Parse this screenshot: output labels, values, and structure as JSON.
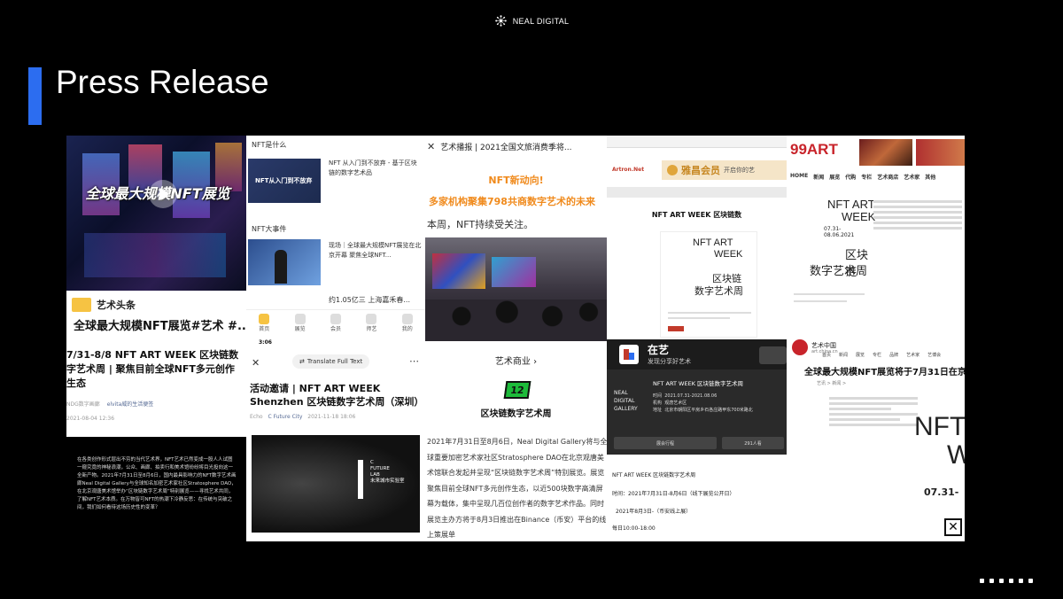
{
  "brand": {
    "name": "NEAL DIGITAL"
  },
  "slide": {
    "title": "Press Release"
  },
  "colors": {
    "accent": "#2c6df0",
    "orange": "#f08a1c",
    "green": "#1dbb3a"
  },
  "p1": {
    "banner": "全球最大规模NFT展览",
    "source": "艺术头条",
    "headline": "全球最大规模NFT展览#艺术 #..."
  },
  "p2": {
    "section1": "NFT是什么",
    "item1_title": "NFT 从入门到不放弃 - 基于区块链的数字艺术品",
    "item1_thumb": "NFT从入门到不放弃",
    "section2": "NFT大事件",
    "item2_title": "现场｜全球最大规模NFT展览在北京开幕 聚焦全球NFT...",
    "item3_title": "约1.05亿三 上海嘉禾春...",
    "tabs": [
      "首页",
      "展览",
      "会员",
      "师艺",
      "我的"
    ]
  },
  "p3": {
    "header": "艺术播报 | 2021全国文旅消费季将...",
    "tag": "NFT新动向!",
    "subtitle": "多家机构聚集798共商数字艺术的未来",
    "body": "本周，NFT持续受关注。"
  },
  "p4": {
    "member": "雅昌会员",
    "member_sub": "开启你的艺",
    "site": "Artron.Net",
    "headline": "NFT ART WEEK 区块链数",
    "poster_l1": "NFT ART",
    "poster_l2": "WEEK",
    "poster_l3": "区块链",
    "poster_l4": "数字艺术周"
  },
  "p5": {
    "logo": "99ART",
    "nav": [
      "HOME",
      "新闻",
      "展览",
      "代购",
      "专栏",
      "艺术商店",
      "艺术家",
      "其他"
    ],
    "poster_l1": "NFT ART",
    "poster_l2": "WEEK",
    "poster_dates": "07.31-08.06.2021",
    "poster_l3": "区块链",
    "poster_l4": "数字艺术周"
  },
  "p6": {
    "headline": "7/31-8/8 NFT ART WEEK 区块链数字艺术周 | 聚焦目前全球NFT多元创作生态",
    "author": "NDG数字画廊",
    "channel": "elvita威的生活便签",
    "date": "2021-08-04 12:36",
    "body": "在各类创作形式层出不穷的当代艺术界，NFT艺术已然变成一股人人试图一窥究竟的神秘浪潮，公众、画廊、拍卖行和美术馆纷纷将目光投向这一全新产物。2021年7月31日至8月6日，国内最具影响力的NFT数字艺术画廊Neal Digital Gallery与全球知名加密艺术家社区Stratosphere DAO，在北京观唐美术馆举办“区块链数字艺术周”特别展览——寻找艺术共同，了解NFT艺术本质。在万物皆可NFT的热潮下冷静反思：在传统与突破之间，我们如何看待这场历史性的变革？"
  },
  "p7": {
    "time": "3:06",
    "translate": "Translate Full Text",
    "headline": "活动邀请 | NFT ART WEEK Shenzhen 区块链数字艺术周（深圳）",
    "author": "Echo",
    "channel": "C Future City",
    "date": "2021-11-18 18:06",
    "logo_l1": "C",
    "logo_l2": "FUTURE",
    "logo_l3": "LAB",
    "logo_l4": "未来城市实验室"
  },
  "p8": {
    "link": "艺术商业 ›",
    "badge": "12",
    "headline": "区块链数字艺术周",
    "body": "2021年7月31日至8月6日，Neal Digital Gallery将与全球重要加密艺术家社区Stratosphere DAO在北京观唐美术馆联合发起并呈现“区块链数字艺术周”特别展览。展览聚焦目前全球NFT多元创作生态，以近500块数字高清屏幕为载体，集中呈现几百位创作者的数字艺术作品。同时展览主办方将于8月3日推出在Binance（币安）平台的线上策展单"
  },
  "p9": {
    "app": "在艺",
    "tagline": "发现分享好艺术",
    "card_title": "NFT ART WEEK 区块链数字艺术周",
    "card_time_label": "时间",
    "card_time": "2021.07.31-2021.08.06",
    "card_org_label": "机构",
    "card_org": "观唐艺术区",
    "card_addr_label": "地址",
    "card_addr": "北京市朝阳区平房乡石各庄路甲东700米路北",
    "card_logo": "NEAL DIGITAL GALLERY",
    "btn1": "展会行程",
    "btn2": "291人看",
    "title": "NFT ART WEEK 区块链数字艺术周",
    "time": "时间：2021年7月31日-8月6日（线下展览公开日）",
    "time2": "2021年8月3日-（币安线上展）",
    "hours": "每日10:00-18:00"
  },
  "p10": {
    "site": "艺术中国",
    "site_sub": "art.china.cn",
    "nav": [
      "首页",
      "新闻",
      "展览",
      "专栏",
      "品牌",
      "艺术家",
      "艺博会"
    ],
    "headline": "全球最大规模NFT展览将于7月31日在京",
    "crumb": "艺讯 > 新闻 >",
    "poster_l1": "NFT",
    "poster_l2": "W",
    "poster_date": "07.31-"
  }
}
